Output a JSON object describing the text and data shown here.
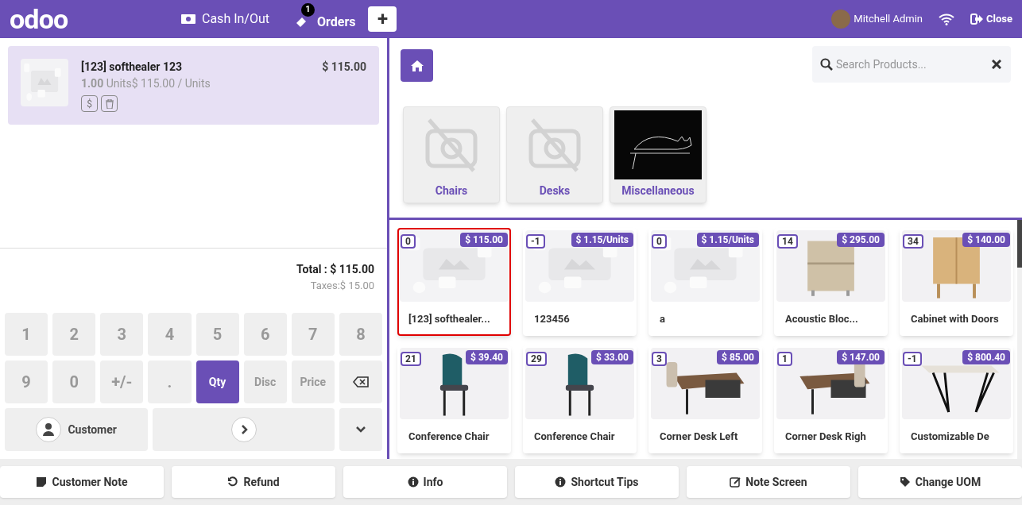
{
  "header": {
    "logo": "odoo",
    "cash_label": "Cash In/Out",
    "orders_label": "Orders",
    "orders_count": "1",
    "new_order": "+",
    "user": "Mitchell Admin",
    "close_label": "Close"
  },
  "order_lines": [
    {
      "name": "[123] softhealer 123",
      "qty": "1.00",
      "unit_text": "Units$ 115.00 / Units",
      "price": "$ 115.00",
      "price_button": "$",
      "selected": true
    }
  ],
  "totals": {
    "total": "Total : $ 115.00",
    "taxes": "Taxes:$ 15.00"
  },
  "numpad": [
    {
      "label": "1",
      "kind": "digit",
      "selected": false
    },
    {
      "label": "2",
      "kind": "digit",
      "selected": false
    },
    {
      "label": "3",
      "kind": "digit",
      "selected": false
    },
    {
      "label": "4",
      "kind": "digit",
      "selected": false
    },
    {
      "label": "5",
      "kind": "digit",
      "selected": false
    },
    {
      "label": "6",
      "kind": "digit",
      "selected": false
    },
    {
      "label": "7",
      "kind": "digit",
      "selected": false
    },
    {
      "label": "8",
      "kind": "digit",
      "selected": false
    },
    {
      "label": "9",
      "kind": "digit",
      "selected": false
    },
    {
      "label": "0",
      "kind": "digit",
      "selected": false
    },
    {
      "label": "+/-",
      "kind": "digit",
      "selected": false
    },
    {
      "label": ".",
      "kind": "digit",
      "selected": false
    },
    {
      "label": "Qty",
      "kind": "mode",
      "selected": true
    },
    {
      "label": "Disc",
      "kind": "mode",
      "selected": false
    },
    {
      "label": "Price",
      "kind": "mode",
      "selected": false
    },
    {
      "kind": "backspace",
      "selected": false
    }
  ],
  "customer_button": "Customer",
  "search": {
    "placeholder": "Search Products..."
  },
  "categories": [
    {
      "name": "Chairs",
      "kind": "no-image"
    },
    {
      "name": "Desks",
      "kind": "no-image"
    },
    {
      "name": "Miscellaneous",
      "kind": "picture"
    }
  ],
  "products": [
    {
      "name": "[123] softhealer...",
      "stock": "0",
      "price": "$ 115.00",
      "selected": true
    },
    {
      "name": "123456",
      "stock": "-1",
      "price": "$ 1.15/Units",
      "selected": false
    },
    {
      "name": "a",
      "stock": "0",
      "price": "$ 1.15/Units",
      "selected": false
    },
    {
      "name": "Acoustic Bloc...",
      "stock": "14",
      "price": "$ 295.00",
      "selected": false
    },
    {
      "name": "Cabinet with Doors",
      "stock": "34",
      "price": "$ 140.00",
      "selected": false
    },
    {
      "name": "Conference Chair",
      "stock": "21",
      "price": "$ 39.40",
      "selected": false
    },
    {
      "name": "Conference Chair",
      "stock": "29",
      "price": "$ 33.00",
      "selected": false
    },
    {
      "name": "Corner Desk Left",
      "stock": "3",
      "price": "$ 85.00",
      "selected": false
    },
    {
      "name": "Corner Desk Righ",
      "stock": "1",
      "price": "$ 147.00",
      "selected": false
    },
    {
      "name": "Customizable De",
      "stock": "-1",
      "price": "$ 800.40",
      "selected": false
    }
  ],
  "action_buttons": [
    {
      "label": "Customer Note",
      "kind": "note"
    },
    {
      "label": "Refund",
      "kind": "refund"
    },
    {
      "label": "Info",
      "kind": "info"
    },
    {
      "label": "Shortcut Tips",
      "kind": "info"
    },
    {
      "label": "Note Screen",
      "kind": "edit"
    },
    {
      "label": "Change UOM",
      "kind": "tag"
    }
  ]
}
